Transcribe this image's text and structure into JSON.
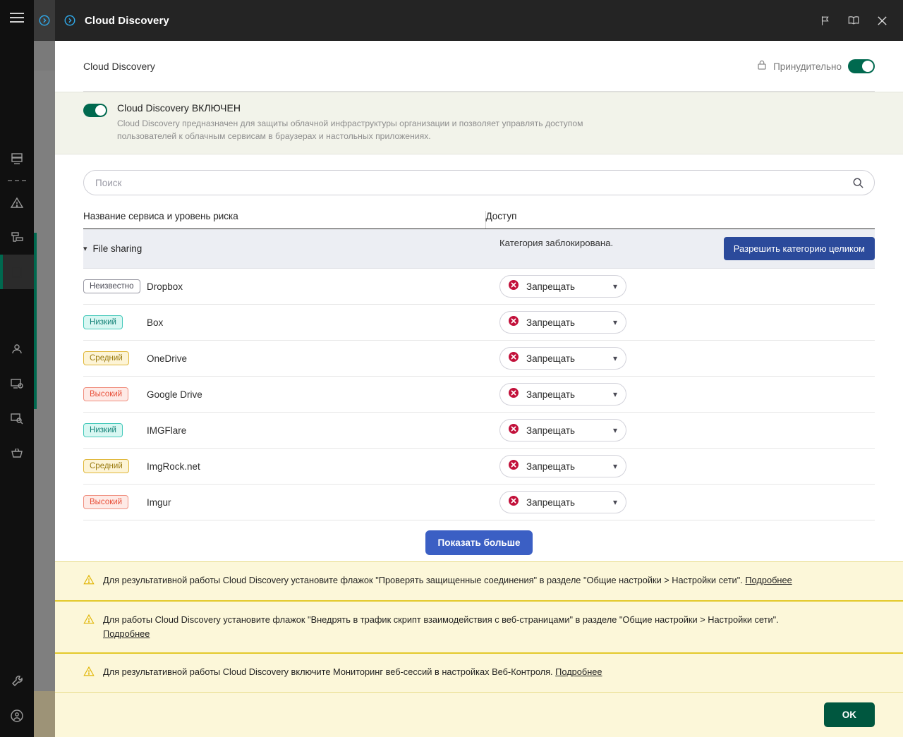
{
  "window": {
    "title": "Cloud Discovery",
    "tab_icon": "chevron-circle-icon",
    "buttons": {
      "flag": "flag-icon",
      "book": "book-icon",
      "close": "close-icon"
    }
  },
  "sidebar": {
    "menu_icon": "hamburger-icon",
    "items": [
      {
        "name": "sidebar-item-devices",
        "icon": "server-icon"
      },
      {
        "name": "sidebar-item-alerts",
        "icon": "warning-triangle-icon"
      },
      {
        "name": "sidebar-item-tasks",
        "icon": "list-tree-icon"
      },
      {
        "name": "sidebar-item-policies",
        "icon": "policy-icon",
        "active": true
      },
      {
        "name": "sidebar-item-users",
        "icon": "user-icon"
      },
      {
        "name": "sidebar-item-settings",
        "icon": "monitor-gear-icon"
      },
      {
        "name": "sidebar-item-discovery",
        "icon": "monitor-search-icon"
      },
      {
        "name": "sidebar-item-licenses",
        "icon": "basket-icon"
      }
    ],
    "bottom_items": [
      {
        "name": "sidebar-item-tools",
        "icon": "wrench-icon"
      },
      {
        "name": "sidebar-item-account",
        "icon": "account-circle-icon"
      }
    ]
  },
  "header": {
    "title": "Cloud Discovery",
    "enforce_label": "Принудительно",
    "lock_icon": "lock-icon",
    "enforce_enabled": true
  },
  "banner": {
    "toggle_enabled": true,
    "title": "Cloud Discovery ВКЛЮЧЕН",
    "description": "Cloud Discovery предназначен для защиты облачной инфраструктуры организации и позволяет управлять доступом пользователей к облачным сервисам в браузерах и настольных приложениях."
  },
  "search": {
    "placeholder": "Поиск",
    "value": "",
    "icon": "search-icon"
  },
  "table": {
    "columns": {
      "name": "Название сервиса и уровень риска",
      "access": "Доступ"
    },
    "category": {
      "label": "File sharing",
      "chevron": "chevron-down-icon",
      "status": "Категория заблокирована.",
      "allow_button": "Разрешить категорию целиком"
    },
    "rows": [
      {
        "risk": "Неизвестно",
        "risk_level": "unknown",
        "service": "Dropbox",
        "access": "Запрещать"
      },
      {
        "risk": "Низкий",
        "risk_level": "low",
        "service": "Box",
        "access": "Запрещать"
      },
      {
        "risk": "Средний",
        "risk_level": "medium",
        "service": "OneDrive",
        "access": "Запрещать"
      },
      {
        "risk": "Высокий",
        "risk_level": "high",
        "service": "Google Drive",
        "access": "Запрещать"
      },
      {
        "risk": "Низкий",
        "risk_level": "low",
        "service": "IMGFlare",
        "access": "Запрещать"
      },
      {
        "risk": "Средний",
        "risk_level": "medium",
        "service": "ImgRock.net",
        "access": "Запрещать"
      },
      {
        "risk": "Высокий",
        "risk_level": "high",
        "service": "Imgur",
        "access": "Запрещать"
      }
    ],
    "show_more": "Показать больше",
    "deny_icon": "deny-circle-icon",
    "access_chevron": "chevron-down-icon"
  },
  "warnings": [
    {
      "icon": "warning-triangle-icon",
      "text": "Для результативной работы Cloud Discovery установите флажок \"Проверять защищенные соединения\" в разделе \"Общие настройки > Настройки сети\". ",
      "link": "Подробнее"
    },
    {
      "icon": "warning-triangle-icon",
      "text": "Для работы Cloud Discovery установите флажок \"Внедрять в трафик скрипт взаимодействия с веб-страницами\" в разделе \"Общие настройки > Настройки сети\".",
      "link": "Подробнее"
    },
    {
      "icon": "warning-triangle-icon",
      "text": "Для результативной работы Cloud Discovery включите Мониторинг веб-сессий в настройках Веб-Контроля. ",
      "link": "Подробнее"
    }
  ],
  "footer": {
    "ok_label": "OK"
  },
  "colors": {
    "accent_green": "#00694f",
    "primary_blue": "#3b5fc4",
    "category_blue": "#2b4a9b",
    "warning_yellow": "#fcf7d9",
    "warning_border": "#e3c92a",
    "deny_red": "#c2103a"
  }
}
